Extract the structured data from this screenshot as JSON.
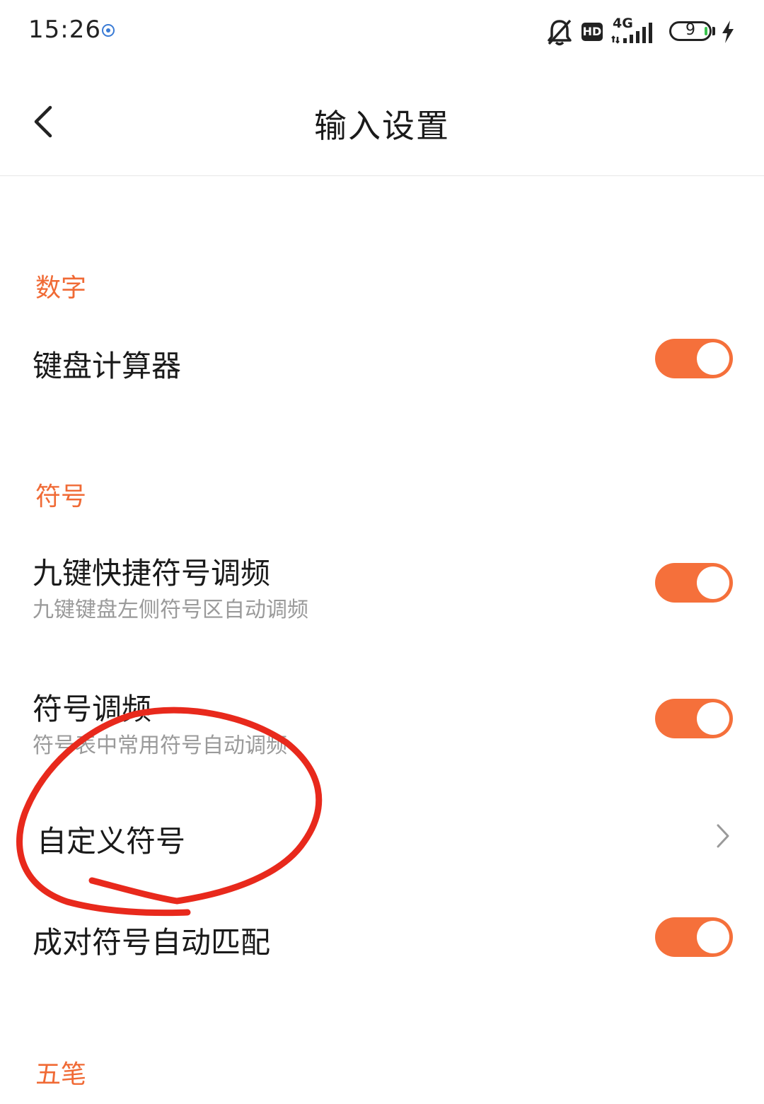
{
  "status_bar": {
    "time": "15:26",
    "network": "4G",
    "hd_label": "HD",
    "battery": "9",
    "icons": [
      "mute-bell-icon",
      "hd-icon",
      "signal-4g-icon",
      "battery-icon",
      "charging-bolt-icon"
    ]
  },
  "header": {
    "title": "输入设置",
    "back_icon": "chevron-left-icon"
  },
  "sections": {
    "digits": {
      "label": "数字",
      "keyboard_calculator": {
        "title": "键盘计算器",
        "enabled": true
      }
    },
    "symbols": {
      "label": "符号",
      "nine_key_symbol_freq": {
        "title": "九键快捷符号调频",
        "subtitle": "九键键盘左侧符号区自动调频",
        "enabled": true
      },
      "symbol_freq": {
        "title": "符号调频",
        "subtitle": "符号表中常用符号自动调频",
        "enabled": true
      },
      "custom_symbols": {
        "title": "自定义符号",
        "icon": "chevron-right-icon"
      },
      "paired_symbols": {
        "title": "成对符号自动匹配",
        "enabled": true
      }
    },
    "wubi": {
      "label": "五笔"
    }
  },
  "colors": {
    "accent": "#f06a35",
    "toggle_on": "#f5703b",
    "annotation": "#e8291c",
    "subtitle": "#9a9a9a"
  }
}
